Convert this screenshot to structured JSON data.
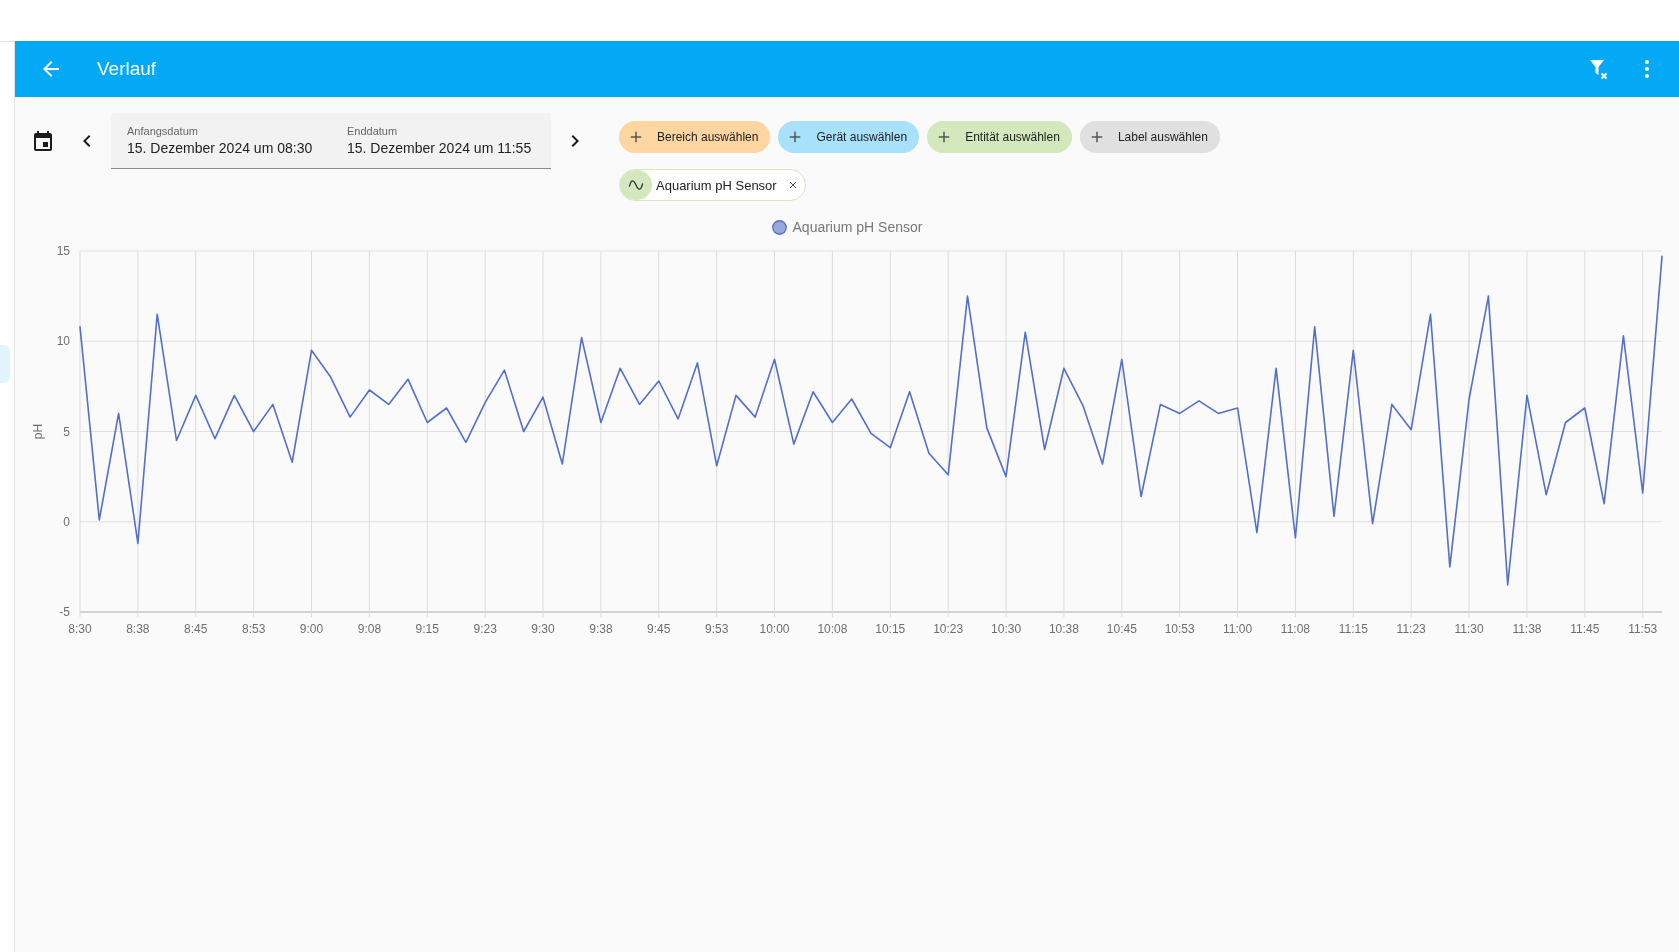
{
  "header": {
    "title": "Verlauf"
  },
  "date_range": {
    "start": {
      "label": "Anfangsdatum",
      "value": "15. Dezember 2024 um 08:30"
    },
    "end": {
      "label": "Enddatum",
      "value": "15. Dezember 2024 um 11:55"
    }
  },
  "target_pickers": [
    {
      "label": "Bereich auswählen",
      "color": "#fdd5a0"
    },
    {
      "label": "Gerät auswählen",
      "color": "#a8e1fb"
    },
    {
      "label": "Entität auswählen",
      "color": "#d3e8bd"
    },
    {
      "label": "Label auswählen",
      "color": "#e0e0e0"
    }
  ],
  "selected_targets": [
    {
      "kind": "entity",
      "label": "Aquarium pH Sensor"
    }
  ],
  "chart": {
    "chart_data": {
      "type": "line",
      "ylabel": "pH",
      "categories": [
        "8:30",
        null,
        null,
        "8:38",
        null,
        null,
        "8:45",
        null,
        null,
        "8:53",
        null,
        null,
        "9:00",
        null,
        null,
        "9:08",
        null,
        null,
        "9:15",
        null,
        null,
        "9:23",
        null,
        null,
        "9:30",
        null,
        null,
        "9:38",
        null,
        null,
        "9:45",
        null,
        null,
        "9:53",
        null,
        null,
        "10:00",
        null,
        null,
        "10:08",
        null,
        null,
        "10:15",
        null,
        null,
        "10:23",
        null,
        null,
        "10:30",
        null,
        null,
        "10:38",
        null,
        null,
        "10:45",
        null,
        null,
        "10:53",
        null,
        null,
        "11:00",
        null,
        null,
        "11:08",
        null,
        null,
        "11:15",
        null,
        null,
        "11:23",
        null,
        null,
        "11:30",
        null,
        null,
        "11:38",
        null,
        null,
        "11:45",
        null,
        null,
        "11:53",
        null
      ],
      "series": [
        {
          "name": "Aquarium pH Sensor",
          "color": "#5470c6",
          "values": [
            10.8,
            0.1,
            6.0,
            -1.2,
            11.5,
            4.5,
            7.0,
            4.6,
            7.0,
            5.0,
            6.5,
            3.3,
            9.5,
            8.0,
            5.8,
            7.3,
            6.5,
            7.9,
            5.5,
            6.3,
            4.4,
            6.6,
            8.4,
            5.0,
            6.9,
            3.2,
            10.2,
            5.5,
            8.5,
            6.5,
            7.8,
            5.7,
            8.8,
            3.1,
            7.0,
            5.8,
            9.0,
            4.3,
            7.2,
            5.5,
            6.8,
            4.9,
            4.1,
            7.2,
            3.8,
            2.6,
            12.5,
            5.2,
            2.5,
            10.5,
            4.0,
            8.5,
            6.4,
            3.2,
            9.0,
            1.4,
            6.5,
            6.0,
            6.7,
            6.0,
            6.3,
            -0.6,
            8.5,
            -0.9,
            10.8,
            0.3,
            9.5,
            -0.1,
            6.5,
            5.1,
            11.5,
            -2.5,
            6.8,
            12.5,
            -3.5,
            7.0,
            1.5,
            5.5,
            6.3,
            1.0,
            10.3,
            1.6,
            14.7
          ]
        }
      ],
      "ylim": [
        -5,
        15
      ],
      "grid": true,
      "yticks": [
        -5,
        0,
        5,
        10,
        15
      ]
    }
  }
}
